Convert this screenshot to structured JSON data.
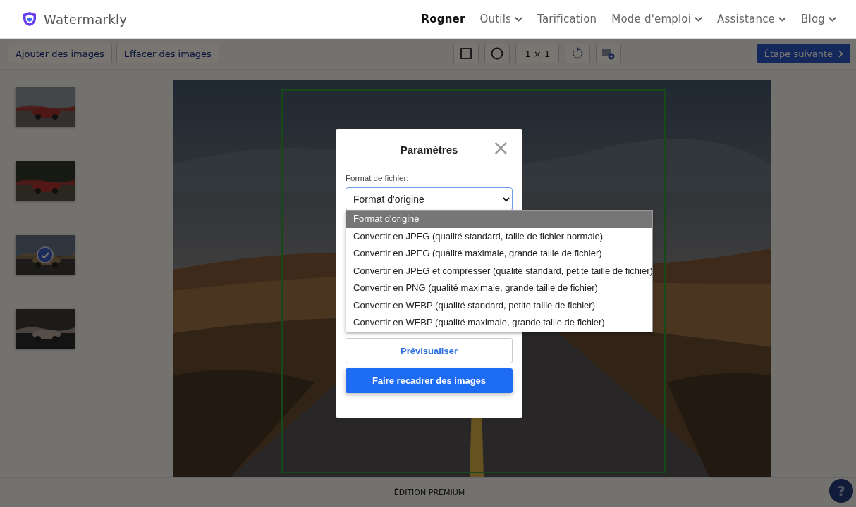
{
  "header": {
    "brand": "Watermarkly",
    "nav": [
      {
        "label": "Rogner",
        "dropdown": false,
        "selected": true
      },
      {
        "label": "Outils",
        "dropdown": true,
        "selected": false
      },
      {
        "label": "Tarification",
        "dropdown": false,
        "selected": false
      },
      {
        "label": "Mode d'emploi",
        "dropdown": true,
        "selected": false
      },
      {
        "label": "Assistance",
        "dropdown": true,
        "selected": false
      },
      {
        "label": "Blog",
        "dropdown": true,
        "selected": false
      }
    ]
  },
  "toolbar": {
    "left_buttons": [
      "Ajouter des images",
      "Effacer des images"
    ],
    "tools": [
      {
        "kind": "square"
      },
      {
        "kind": "circle"
      },
      {
        "kind": "ratio",
        "label": "1 × 1"
      },
      {
        "kind": "rotate"
      },
      {
        "kind": "image-add"
      }
    ],
    "next_button": "Étape suivante"
  },
  "thumbnails": [
    {
      "kind": "picture",
      "selected": false
    },
    {
      "kind": "picture",
      "selected": false
    },
    {
      "kind": "picture",
      "selected": true
    },
    {
      "kind": "picture",
      "selected": false
    }
  ],
  "footer": "ÉDITION PREMIUM",
  "help_button": "?",
  "dialog": {
    "title": "Paramètres",
    "close": "×",
    "field_label": "Format de fichier:",
    "value": "Format d'origine",
    "options": [
      {
        "label": "Format d'origine",
        "selected": true
      },
      {
        "label": "Convertir en JPEG (qualité standard, taille de fichier normale)",
        "selected": false
      },
      {
        "label": "Convertir en JPEG (qualité maximale, grande taille de fichier)",
        "selected": false
      },
      {
        "label": "Convertir en JPEG et compresser (qualité standard, petite taille de fichier)",
        "selected": false
      },
      {
        "label": "Convertir en PNG (qualité maximale, grande taille de fichier)",
        "selected": false
      },
      {
        "label": "Convertir en WEBP (qualité standard, petite taille de fichier)",
        "selected": false
      },
      {
        "label": "Convertir en WEBP (qualité maximale, grande taille de fichier)",
        "selected": false
      }
    ],
    "preview_button": "Prévisualiser",
    "primary_button": "Faire recadrer des images"
  }
}
